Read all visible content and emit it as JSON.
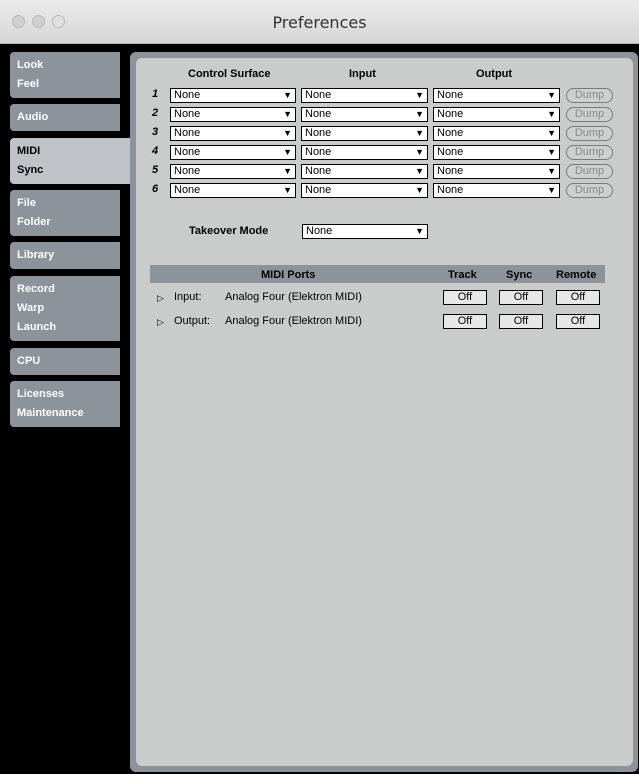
{
  "window": {
    "title": "Preferences"
  },
  "sidebar": {
    "tabs": [
      {
        "lines": [
          "Look",
          "Feel"
        ]
      },
      {
        "lines": [
          "Audio"
        ]
      },
      {
        "lines": [
          "MIDI",
          "Sync"
        ]
      },
      {
        "lines": [
          "File",
          "Folder"
        ]
      },
      {
        "lines": [
          "Library"
        ]
      },
      {
        "lines": [
          "Record",
          "Warp",
          "Launch"
        ]
      },
      {
        "lines": [
          "CPU"
        ]
      },
      {
        "lines": [
          "Licenses",
          "Maintenance"
        ]
      }
    ],
    "active_index": 2
  },
  "surfaces": {
    "headers": {
      "control_surface": "Control Surface",
      "input": "Input",
      "output": "Output"
    },
    "rows": [
      {
        "num": "1",
        "control_surface": "None",
        "input": "None",
        "output": "None",
        "dump": "Dump"
      },
      {
        "num": "2",
        "control_surface": "None",
        "input": "None",
        "output": "None",
        "dump": "Dump"
      },
      {
        "num": "3",
        "control_surface": "None",
        "input": "None",
        "output": "None",
        "dump": "Dump"
      },
      {
        "num": "4",
        "control_surface": "None",
        "input": "None",
        "output": "None",
        "dump": "Dump"
      },
      {
        "num": "5",
        "control_surface": "None",
        "input": "None",
        "output": "None",
        "dump": "Dump"
      },
      {
        "num": "6",
        "control_surface": "None",
        "input": "None",
        "output": "None",
        "dump": "Dump"
      }
    ]
  },
  "takeover": {
    "label": "Takeover Mode",
    "value": "None"
  },
  "midi_ports": {
    "headers": {
      "ports": "MIDI Ports",
      "track": "Track",
      "sync": "Sync",
      "remote": "Remote"
    },
    "rows": [
      {
        "direction": "Input:",
        "device": "Analog Four (Elektron MIDI)",
        "track": "Off",
        "sync": "Off",
        "remote": "Off"
      },
      {
        "direction": "Output:",
        "device": "Analog Four (Elektron MIDI)",
        "track": "Off",
        "sync": "Off",
        "remote": "Off"
      }
    ]
  }
}
